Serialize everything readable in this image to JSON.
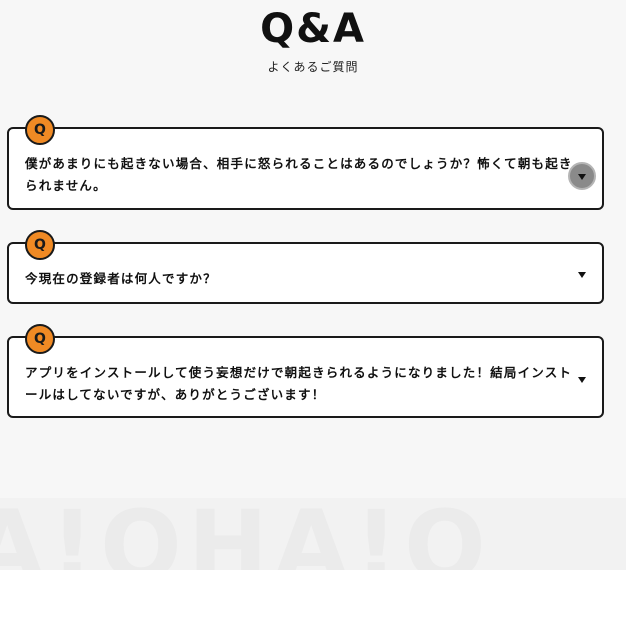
{
  "header": {
    "title": "Q&A",
    "subtitle": "よくあるご質問"
  },
  "faq": {
    "badge_label": "Q",
    "items": [
      {
        "line1": "僕があまりにも起きない場合、相手に怒られることはあるのでしょうか？怖くて朝も起き",
        "line2": "られません。"
      },
      {
        "line1": "今現在の登録者は何人ですか？",
        "line2": ""
      },
      {
        "line1": "アプリをインストールして使う妄想だけで朝起きられるようになりました！結局インスト",
        "line2": "ールはしてないですが、ありがとうございます！"
      }
    ]
  },
  "background": {
    "decorative_text": "A!OHA!O"
  },
  "colors": {
    "badge": "#f08a24",
    "border": "#1a1a1a",
    "page_background": "#f7f7f7"
  },
  "icons": {
    "toggle": "chevron-down-icon"
  }
}
